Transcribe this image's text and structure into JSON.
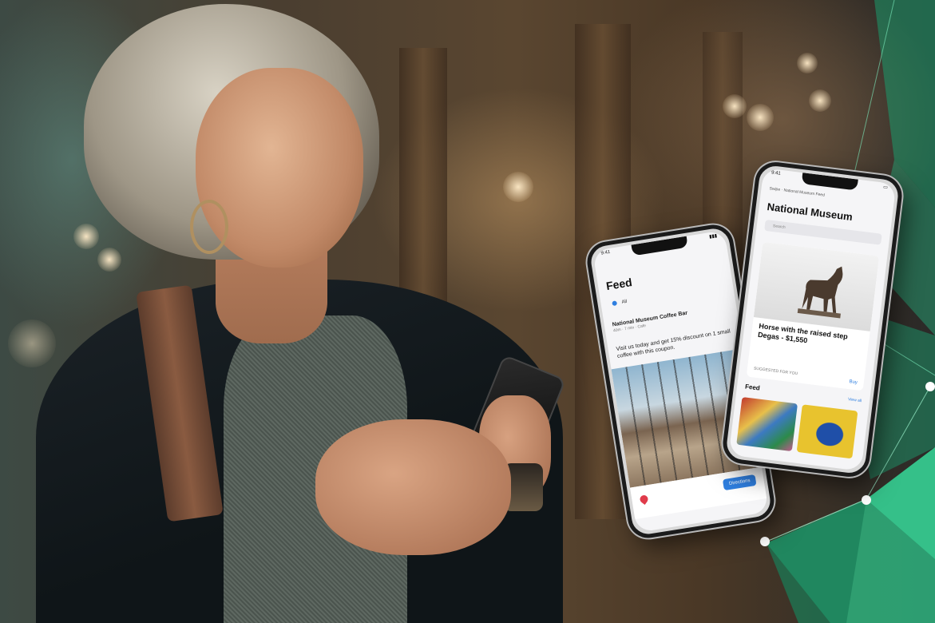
{
  "scene": {
    "description_colors": {
      "accent_green": "#2ec48a",
      "bokeh": "#ffe9c4"
    }
  },
  "phone_feed": {
    "status_time": "9:41",
    "title": "Feed",
    "chip": "All",
    "post": {
      "name": "National Museum Coffee Bar",
      "meta": "40m · 7 min · Cafe",
      "body": "Visit us today and get 15% discount on 1 small coffee with this coupon."
    },
    "button": "Directions"
  },
  "phone_museum": {
    "status_time": "9:41",
    "topline": "Swipe · National Museum Feed",
    "title": "National Museum",
    "search_placeholder": "Search",
    "art_caption": "Horse with the raised step Degas - $1,550",
    "art_meta": "SUGGESTED FOR YOU",
    "art_buy": "Buy",
    "feed_label": "Feed",
    "view_all": "View all"
  }
}
